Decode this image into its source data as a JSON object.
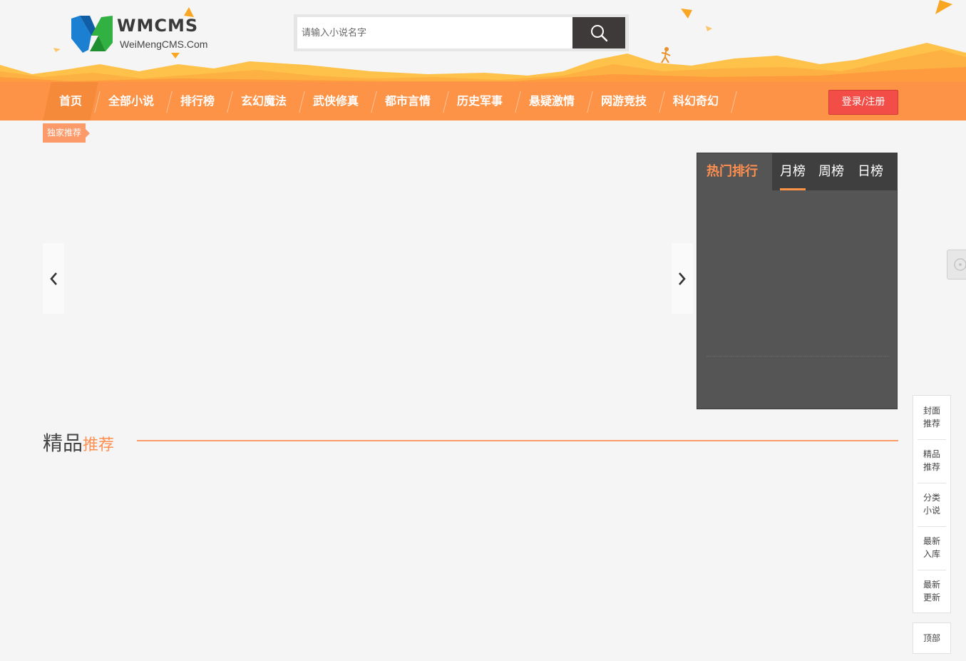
{
  "header": {
    "logo": {
      "brand": "WMCMS",
      "domain": "WeiMengCMS.Com"
    },
    "search": {
      "placeholder": "请输入小说名字",
      "value": "",
      "button_icon": "search-icon"
    }
  },
  "nav": {
    "items": [
      {
        "label": "首页",
        "active": true
      },
      {
        "label": "全部小说"
      },
      {
        "label": "排行榜"
      },
      {
        "label": "玄幻魔法"
      },
      {
        "label": "武侠修真"
      },
      {
        "label": "都市言情"
      },
      {
        "label": "历史军事"
      },
      {
        "label": "悬疑激情"
      },
      {
        "label": "网游竞技"
      },
      {
        "label": "科幻奇幻"
      }
    ],
    "login_label": "登录/注册"
  },
  "banner": {
    "tag": "独家推荐",
    "prev_icon": "chevron-left-icon",
    "next_icon": "chevron-right-icon"
  },
  "ranking": {
    "title": "热门排行",
    "tabs": [
      {
        "label": "月榜",
        "active": true
      },
      {
        "label": "周榜"
      },
      {
        "label": "日榜"
      }
    ]
  },
  "section": {
    "title_main": "精品",
    "title_highlight": "推荐"
  },
  "side_nav": {
    "items": [
      {
        "line1": "封面",
        "line2": "推荐"
      },
      {
        "line1": "精品",
        "line2": "推荐"
      },
      {
        "line1": "分类",
        "line2": "小说"
      },
      {
        "line1": "最新",
        "line2": "入库"
      },
      {
        "line1": "最新",
        "line2": "更新"
      }
    ],
    "top_label": "顶部"
  },
  "colors": {
    "accent": "#fd9346",
    "login": "#f24e47",
    "rank_bg": "#555555",
    "highlight": "#fd8f50"
  }
}
